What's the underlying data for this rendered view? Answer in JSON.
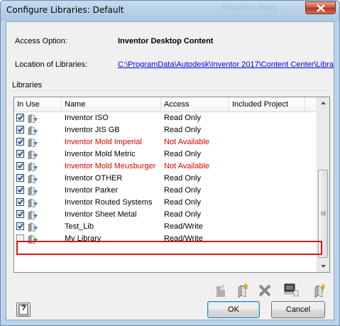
{
  "window": {
    "title": "Configure Libraries: Default",
    "title_behind_text": "... focused on library ..."
  },
  "access_option": {
    "label": "Access Option:",
    "value": "Inventor Desktop Content"
  },
  "location": {
    "label": "Location of Libraries:",
    "path": "C:\\ProgramData\\Autodesk\\Inventor 2017\\Content Center\\Libra"
  },
  "libraries_group_label": "Libraries",
  "columns": [
    "In Use",
    "Name",
    "Access",
    "Included Project"
  ],
  "rows": [
    {
      "checked": true,
      "name": "Inventor ISO",
      "access": "Read Only",
      "project": "",
      "available": true
    },
    {
      "checked": true,
      "name": "Inventor JIS GB",
      "access": "Read Only",
      "project": "",
      "available": true
    },
    {
      "checked": true,
      "name": "Inventor Mold Imperial",
      "access": "Not Available",
      "project": "",
      "available": false
    },
    {
      "checked": true,
      "name": "Inventor Mold Metric",
      "access": "Read Only",
      "project": "",
      "available": true
    },
    {
      "checked": true,
      "name": "Inventor Mold Meusburger",
      "access": "Not Available",
      "project": "",
      "available": false
    },
    {
      "checked": true,
      "name": "Inventor OTHER",
      "access": "Read Only",
      "project": "",
      "available": true
    },
    {
      "checked": true,
      "name": "Inventor Parker",
      "access": "Read Only",
      "project": "",
      "available": true
    },
    {
      "checked": true,
      "name": "Inventor Routed Systems",
      "access": "Read Only",
      "project": "",
      "available": true
    },
    {
      "checked": true,
      "name": "Inventor Sheet Metal",
      "access": "Read Only",
      "project": "",
      "available": true
    },
    {
      "checked": true,
      "name": "Test_Lib",
      "access": "Read/Write",
      "project": "",
      "available": true
    },
    {
      "checked": false,
      "name": "My Library",
      "access": "Read/Write",
      "project": "",
      "available": true
    }
  ],
  "toolbar": {
    "icons": [
      "library-icon-disabled",
      "create-library-icon",
      "remove-library-icon",
      "import-library-icon",
      "migrate-library-icon"
    ]
  },
  "buttons": {
    "ok": "OK",
    "cancel": "Cancel",
    "help": "?"
  },
  "colors": {
    "unavailable_text": "#e00000",
    "highlight_border": "#d6171a",
    "link": "#0000ee"
  }
}
